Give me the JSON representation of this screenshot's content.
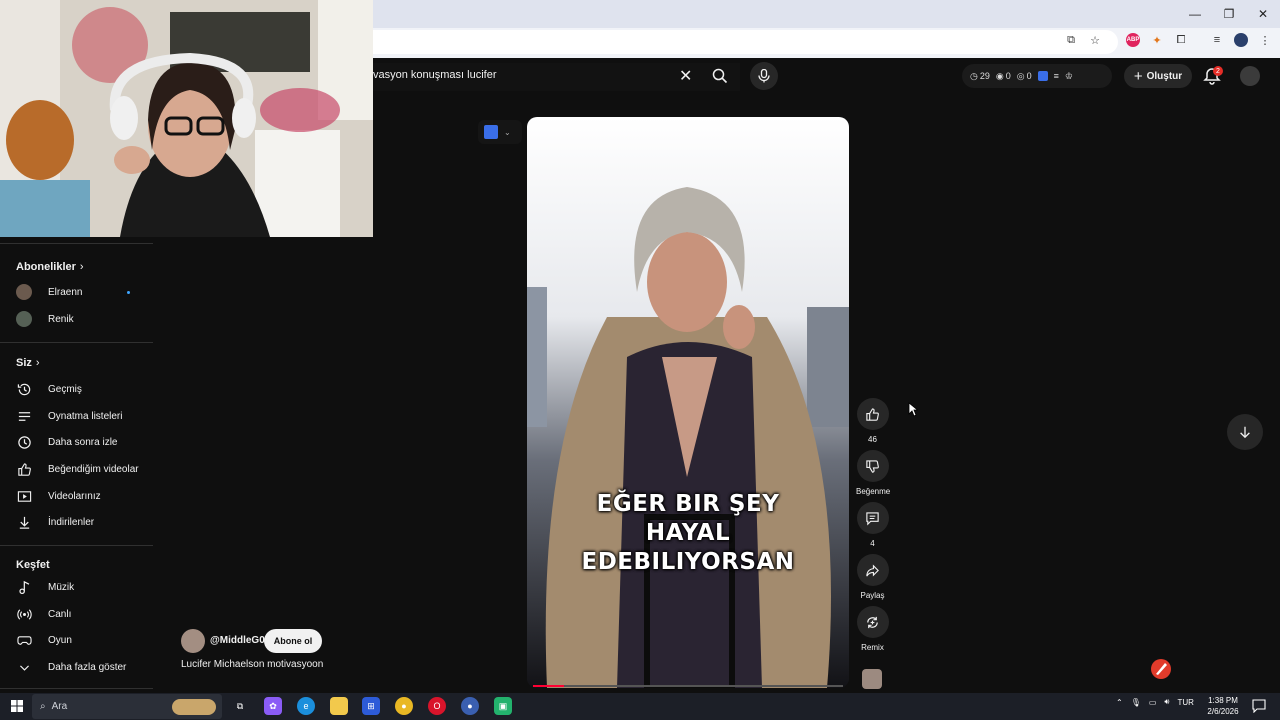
{
  "search": {
    "query": "vasyon konuşması lucifer"
  },
  "header": {
    "stats": {
      "watch_time": "29",
      "views": "0",
      "third": "0"
    },
    "create_label": "Oluştur",
    "notif_count": "2"
  },
  "sidebar": {
    "subs_title": "Abonelikler",
    "subs": [
      {
        "label": "Elraenn",
        "new": true
      },
      {
        "label": "Renik",
        "new": false
      }
    ],
    "you_title": "Siz",
    "you_items": [
      {
        "label": "Geçmiş",
        "icon": "history-icon"
      },
      {
        "label": "Oynatma listeleri",
        "icon": "playlist-icon"
      },
      {
        "label": "Daha sonra izle",
        "icon": "clock-icon"
      },
      {
        "label": "Beğendiğim videolar",
        "icon": "thumb-up-icon"
      },
      {
        "label": "Videolarınız",
        "icon": "video-icon"
      },
      {
        "label": "İndirilenler",
        "icon": "download-icon"
      }
    ],
    "explore_title": "Keşfet",
    "explore_items": [
      {
        "label": "Müzik",
        "icon": "music-icon"
      },
      {
        "label": "Canlı",
        "icon": "live-icon"
      },
      {
        "label": "Oyun",
        "icon": "game-icon"
      },
      {
        "label": "Daha fazla göster",
        "icon": "chevron-down-icon"
      }
    ]
  },
  "short": {
    "caption_lines": [
      "EĞER BIR ŞEY",
      "HAYAL",
      "EDEBILIYORSAN"
    ],
    "progress": 0.1,
    "channel": "@MiddleG0",
    "subscribe_label": "Abone ol",
    "title": "Lucifer Michaelson motivasyoon"
  },
  "actions": {
    "likes": "46",
    "dislike_label": "Beğenme",
    "comments": "4",
    "share_label": "Paylaş",
    "remix_label": "Remix"
  },
  "taskbar": {
    "search_placeholder": "Ara",
    "lang": "TUR",
    "time": "1:38 PM",
    "date": "2/6/2026"
  }
}
